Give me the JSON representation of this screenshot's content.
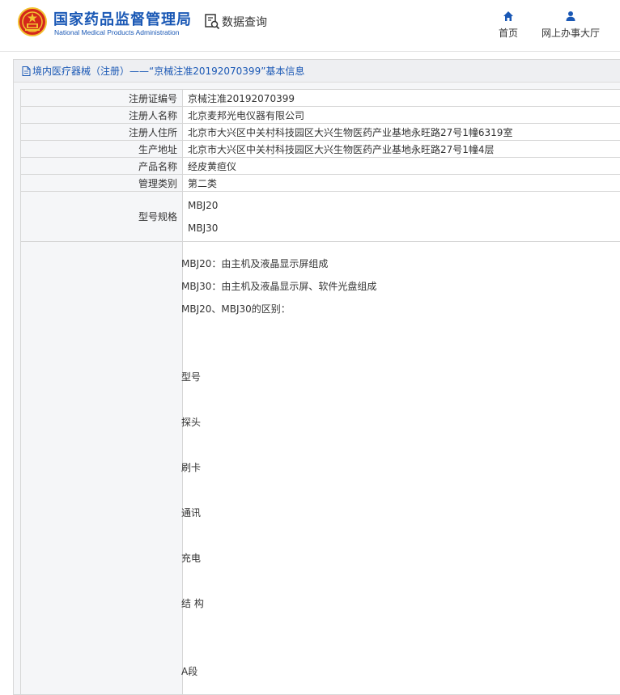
{
  "header": {
    "brand_cn": "国家药品监督管理局",
    "brand_en": "National Medical Products Administration",
    "db_query_label": "数据查询",
    "nav": [
      {
        "label": "首页",
        "icon": "home-icon"
      },
      {
        "label": "网上办事大厅",
        "icon": "user-icon"
      }
    ]
  },
  "panel": {
    "title": "境内医疗器械（注册）——“京械注准20192070399”基本信息",
    "rows": [
      {
        "label": "注册证编号",
        "value": "京械注准20192070399"
      },
      {
        "label": "注册人名称",
        "value": "北京麦邦光电仪器有限公司"
      },
      {
        "label": "注册人住所",
        "value": "北京市大兴区中关村科技园区大兴生物医药产业基地永旺路27号1幢6319室"
      },
      {
        "label": "生产地址",
        "value": "北京市大兴区中关村科技园区大兴生物医药产业基地永旺路27号1幢4层"
      },
      {
        "label": "产品名称",
        "value": "经皮黄疸仪"
      },
      {
        "label": "管理类别",
        "value": "第二类"
      }
    ],
    "model": {
      "label": "型号规格",
      "values": [
        "MBJ20",
        "MBJ30"
      ]
    },
    "description": [
      "MBJ20：由主机及液晶显示屏组成",
      "MBJ30：由主机及液晶显示屏、软件光盘组成",
      "MBJ20、MBJ30的区别：",
      "型号",
      "探头",
      "刷卡",
      "通讯",
      "充电",
      "结 构",
      "A段"
    ]
  },
  "colors": {
    "brand_blue": "#1a58b5",
    "emblem_red": "#d4271b",
    "emblem_gold": "#f2c230"
  }
}
